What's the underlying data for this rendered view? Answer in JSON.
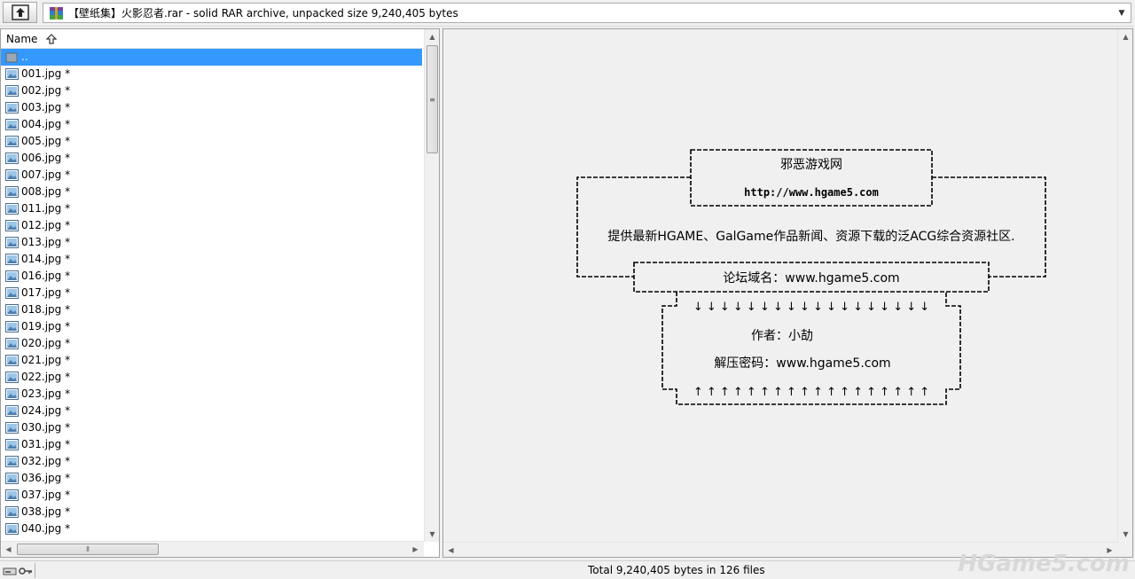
{
  "window": {
    "archive_path": "【壁纸集】火影忍者.rar - solid RAR archive, unpacked size 9,240,405 bytes"
  },
  "file_list": {
    "column_name": "Name",
    "parent": "..",
    "files": [
      "001.jpg *",
      "002.jpg *",
      "003.jpg *",
      "004.jpg *",
      "005.jpg *",
      "006.jpg *",
      "007.jpg *",
      "008.jpg *",
      "011.jpg *",
      "012.jpg *",
      "013.jpg *",
      "014.jpg *",
      "016.jpg *",
      "017.jpg *",
      "018.jpg *",
      "019.jpg *",
      "020.jpg *",
      "021.jpg *",
      "022.jpg *",
      "023.jpg *",
      "024.jpg *",
      "030.jpg *",
      "031.jpg *",
      "032.jpg *",
      "036.jpg *",
      "037.jpg *",
      "038.jpg *",
      "040.jpg *"
    ]
  },
  "viewer": {
    "site_name": "邪恶游戏网",
    "site_url": "http://www.hgame5.com",
    "description": "提供最新HGAME、GalGame作品新闻、资源下载的泛ACG综合资源社区.",
    "forum_domain": "论坛域名：www.hgame5.com",
    "author": "作者：小劼",
    "password": "解压密码：www.hgame5.com",
    "arrows_down": "↓ ↓ ↓ ↓ ↓ ↓ ↓ ↓ ↓ ↓ ↓ ↓ ↓ ↓ ↓ ↓ ↓ ↓",
    "arrows_up": "↑ ↑ ↑ ↑ ↑ ↑ ↑ ↑ ↑ ↑ ↑ ↑ ↑ ↑ ↑ ↑ ↑ ↑"
  },
  "status": {
    "summary": "Total 9,240,405 bytes in 126 files",
    "watermark": "HGame5.com"
  },
  "icons": {
    "up_folder": "up-folder-icon",
    "archive": "rar-archive-icon",
    "sort": "sort-ascending-icon",
    "folder": "folder-icon",
    "image_file": "image-file-icon",
    "status_drive": "drive-icon",
    "status_key": "key-icon"
  },
  "colors": {
    "selection": "#3399ff",
    "pane_bg": "#f0f0f0"
  }
}
